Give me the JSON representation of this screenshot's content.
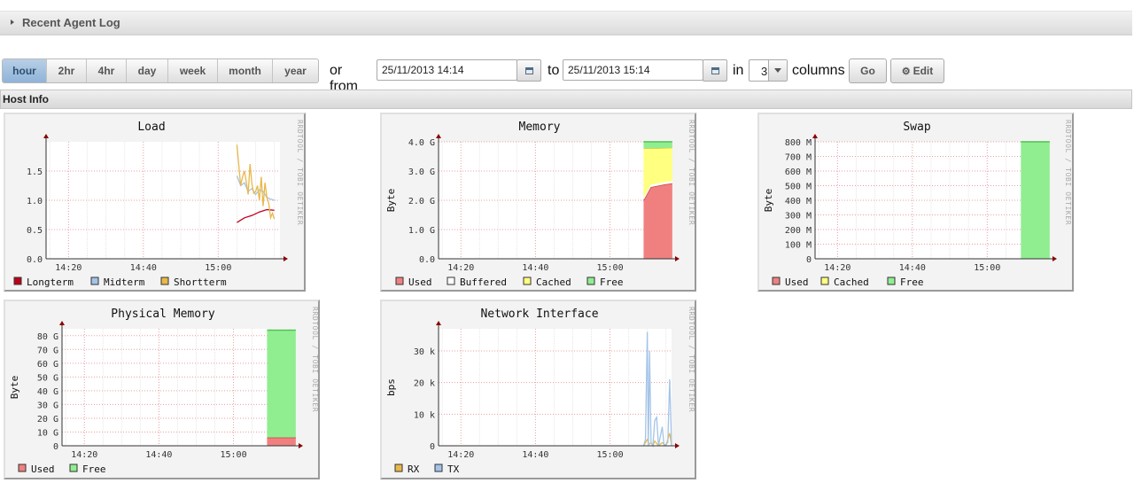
{
  "agent_log": {
    "title": "Recent Agent Log"
  },
  "range_buttons": [
    "hour",
    "2hr",
    "4hr",
    "day",
    "week",
    "month",
    "year"
  ],
  "active_range": "hour",
  "date_range": {
    "or_from_label": "or from",
    "from": "25/11/2013 14:14",
    "to_label": "to",
    "to": "25/11/2013 15:14",
    "in_label": "in",
    "columns": "3",
    "columns_label": "columns",
    "go_label": "Go",
    "edit_label": "Edit"
  },
  "host_info": {
    "title": "Host Info"
  },
  "watermark": "RRDTOOL / TOBI OETIKER",
  "x_ticks": [
    "14:20",
    "14:40",
    "15:00"
  ],
  "colors": {
    "used": "#f08080",
    "free": "#90ee90",
    "cached": "#ffff80",
    "buffered": "#ffffff",
    "longterm": "#c0001a",
    "midterm": "#a3c4e8",
    "shortterm": "#e8b84a",
    "rx": "#e8b84a",
    "tx": "#a3c4e8"
  },
  "chart_data": [
    {
      "type": "line",
      "title": "Load",
      "ylabel": "",
      "ylim": [
        0,
        2.0
      ],
      "yticks": [
        {
          "v": 0,
          "t": "0.0"
        },
        {
          "v": 0.5,
          "t": "0.5"
        },
        {
          "v": 1.0,
          "t": "1.0"
        },
        {
          "v": 1.5,
          "t": "1.5"
        }
      ],
      "series": [
        {
          "name": "Longterm",
          "color": "#c0001a",
          "points": [
            [
              15.05,
              0.62
            ],
            [
              15.07,
              0.7
            ],
            [
              15.09,
              0.74
            ],
            [
              15.11,
              0.8
            ],
            [
              15.13,
              0.84
            ],
            [
              15.15,
              0.83
            ]
          ]
        },
        {
          "name": "Midterm",
          "color": "#a3c4e8",
          "points": [
            [
              15.05,
              1.42
            ],
            [
              15.06,
              1.25
            ],
            [
              15.07,
              1.3
            ],
            [
              15.08,
              1.15
            ],
            [
              15.09,
              1.2
            ],
            [
              15.1,
              1.1
            ],
            [
              15.11,
              1.18
            ],
            [
              15.12,
              1.15
            ],
            [
              15.13,
              1.05
            ],
            [
              15.14,
              1.02
            ],
            [
              15.15,
              1.0
            ]
          ]
        },
        {
          "name": "Shortterm",
          "color": "#e8b84a",
          "points": [
            [
              15.05,
              1.95
            ],
            [
              15.055,
              1.6
            ],
            [
              15.06,
              1.25
            ],
            [
              15.065,
              1.4
            ],
            [
              15.07,
              1.5
            ],
            [
              15.075,
              1.32
            ],
            [
              15.08,
              1.1
            ],
            [
              15.085,
              1.62
            ],
            [
              15.09,
              1.28
            ],
            [
              15.095,
              1.12
            ],
            [
              15.1,
              1.15
            ],
            [
              15.105,
              1.25
            ],
            [
              15.11,
              1.0
            ],
            [
              15.115,
              1.4
            ],
            [
              15.12,
              0.9
            ],
            [
              15.125,
              1.3
            ],
            [
              15.13,
              1.05
            ],
            [
              15.135,
              0.95
            ],
            [
              15.14,
              0.7
            ],
            [
              15.145,
              0.78
            ],
            [
              15.15,
              0.68
            ]
          ]
        }
      ]
    },
    {
      "type": "area",
      "title": "Memory",
      "ylabel": "Byte",
      "ylim": [
        0,
        4.0
      ],
      "yticks": [
        {
          "v": 0,
          "t": "0.0"
        },
        {
          "v": 1,
          "t": "1.0 G"
        },
        {
          "v": 2,
          "t": "2.0 G"
        },
        {
          "v": 3,
          "t": "3.0 G"
        },
        {
          "v": 4,
          "t": "4.0 G"
        }
      ],
      "x_start": 15.09,
      "x_end": 15.167,
      "stack": [
        {
          "name": "Used",
          "color": "#f08080",
          "edge": "#d04040",
          "values": [
            2.0,
            2.45,
            2.5,
            2.55,
            2.58
          ]
        },
        {
          "name": "Buffered",
          "color": "#ffffff",
          "edge": "#ffffff",
          "values": [
            0.08,
            0.08,
            0.08,
            0.08,
            0.08
          ]
        },
        {
          "name": "Cached",
          "color": "#ffff80",
          "edge": "#e0d040",
          "values": [
            1.7,
            1.25,
            1.2,
            1.16,
            1.14
          ]
        },
        {
          "name": "Free",
          "color": "#90ee90",
          "edge": "#50c050",
          "values": [
            0.22,
            0.22,
            0.22,
            0.21,
            0.2
          ]
        }
      ]
    },
    {
      "type": "area",
      "title": "Swap",
      "ylabel": "Byte",
      "ylim": [
        0,
        800
      ],
      "yticks": [
        {
          "v": 0,
          "t": "0"
        },
        {
          "v": 100,
          "t": "100 M"
        },
        {
          "v": 200,
          "t": "200 M"
        },
        {
          "v": 300,
          "t": "300 M"
        },
        {
          "v": 400,
          "t": "400 M"
        },
        {
          "v": 500,
          "t": "500 M"
        },
        {
          "v": 600,
          "t": "600 M"
        },
        {
          "v": 700,
          "t": "700 M"
        },
        {
          "v": 800,
          "t": "800 M"
        }
      ],
      "x_start": 15.09,
      "x_end": 15.167,
      "stack": [
        {
          "name": "Used",
          "color": "#f08080",
          "edge": "#d04040",
          "values": [
            0,
            0
          ]
        },
        {
          "name": "Cached",
          "color": "#ffff80",
          "edge": "#e0d040",
          "values": [
            0,
            0
          ]
        },
        {
          "name": "Free",
          "color": "#90ee90",
          "edge": "#50c050",
          "values": [
            800,
            800
          ]
        }
      ]
    },
    {
      "type": "area",
      "title": "Physical Memory",
      "ylabel": "Byte",
      "ylim": [
        0,
        85
      ],
      "yticks": [
        {
          "v": 0,
          "t": "0"
        },
        {
          "v": 10,
          "t": "10 G"
        },
        {
          "v": 20,
          "t": "20 G"
        },
        {
          "v": 30,
          "t": "30 G"
        },
        {
          "v": 40,
          "t": "40 G"
        },
        {
          "v": 50,
          "t": "50 G"
        },
        {
          "v": 60,
          "t": "60 G"
        },
        {
          "v": 70,
          "t": "70 G"
        },
        {
          "v": 80,
          "t": "80 G"
        }
      ],
      "x_start": 15.09,
      "x_end": 15.167,
      "stack": [
        {
          "name": "Used",
          "color": "#f08080",
          "edge": "#d04040",
          "values": [
            6,
            6
          ]
        },
        {
          "name": "Free",
          "color": "#90ee90",
          "edge": "#50c050",
          "values": [
            78,
            78
          ]
        }
      ]
    },
    {
      "type": "line",
      "title": "Network Interface",
      "ylabel": "bps",
      "ylim": [
        0,
        37
      ],
      "yticks": [
        {
          "v": 0,
          "t": "0"
        },
        {
          "v": 10,
          "t": "10 k"
        },
        {
          "v": 20,
          "t": "20 k"
        },
        {
          "v": 30,
          "t": "30 k"
        }
      ],
      "series": [
        {
          "name": "RX",
          "color": "#e8b84a",
          "points": [
            [
              15.09,
              0
            ],
            [
              15.1,
              2
            ],
            [
              15.105,
              0.5
            ],
            [
              15.11,
              1
            ],
            [
              15.115,
              0
            ],
            [
              15.12,
              1.5
            ],
            [
              15.13,
              0
            ],
            [
              15.14,
              1
            ],
            [
              15.15,
              0
            ],
            [
              15.16,
              4
            ],
            [
              15.165,
              0
            ]
          ]
        },
        {
          "name": "TX",
          "color": "#a3c4e8",
          "points": [
            [
              15.09,
              0
            ],
            [
              15.095,
              2
            ],
            [
              15.1,
              36
            ],
            [
              15.103,
              0
            ],
            [
              15.106,
              30
            ],
            [
              15.11,
              1
            ],
            [
              15.115,
              0
            ],
            [
              15.12,
              8
            ],
            [
              15.125,
              9
            ],
            [
              15.13,
              0
            ],
            [
              15.14,
              6
            ],
            [
              15.145,
              0
            ],
            [
              15.155,
              1
            ],
            [
              15.16,
              21
            ],
            [
              15.165,
              0
            ]
          ]
        }
      ]
    }
  ]
}
